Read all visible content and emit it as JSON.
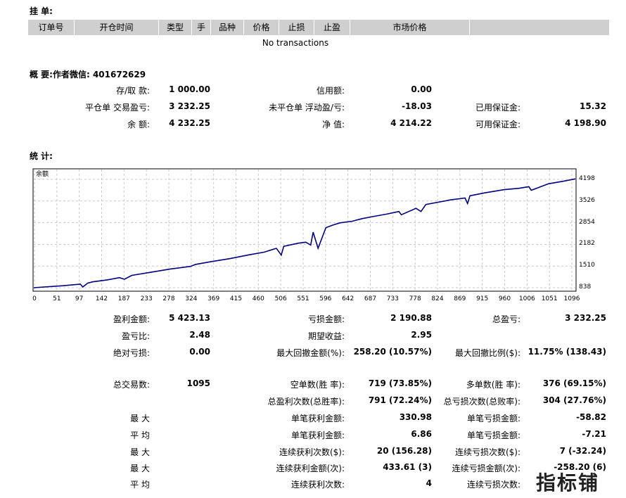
{
  "orders": {
    "title": "挂 单:",
    "columns": [
      "订单号",
      "开仓时间",
      "类型",
      "手",
      "品种",
      "价格",
      "止损",
      "止盈",
      "市场价格",
      ""
    ],
    "empty": "No transactions"
  },
  "summary": {
    "title": "概 要:作者微信: 401672629",
    "rows": [
      [
        [
          "存/取 款:",
          "1 000.00"
        ],
        [
          "信用额:",
          "0.00"
        ],
        [
          "",
          ""
        ]
      ],
      [
        [
          "平仓单 交易盈亏:",
          "3 232.25"
        ],
        [
          "未平仓单 浮动盈/亏:",
          "-18.03"
        ],
        [
          "已用保证金:",
          "15.32"
        ]
      ],
      [
        [
          "余 额:",
          "4 232.25"
        ],
        [
          "净 值:",
          "4 214.22"
        ],
        [
          "可用保证金:",
          "4 198.90"
        ]
      ]
    ]
  },
  "stats": {
    "title": "统 计:",
    "rows": [
      [
        [
          "盈利金额:",
          "5 423.13"
        ],
        [
          "亏损金额:",
          "2 190.88"
        ],
        [
          "总盈亏:",
          "3 232.25"
        ]
      ],
      [
        [
          "盈亏比:",
          "2.48"
        ],
        [
          "期望收益:",
          "2.95"
        ],
        [
          "",
          ""
        ]
      ],
      [
        [
          "绝对亏损:",
          "0.00"
        ],
        [
          "最大回撤金额(%):",
          "258.20 (10.57%)"
        ],
        [
          "最大回撤比例($):",
          "11.75% (138.43)"
        ]
      ],
      [
        [
          "总交易数:",
          "1095"
        ],
        [
          "空单数(胜 率):",
          "719 (73.85%)"
        ],
        [
          "多单数(胜 率):",
          "376 (69.15%)"
        ]
      ],
      [
        [
          "",
          ""
        ],
        [
          "总盈利次数(总胜率):",
          "791 (72.24%)"
        ],
        [
          "总亏损次数(总败率):",
          "304 (27.76%)"
        ]
      ],
      [
        [
          "最 大",
          ""
        ],
        [
          "单笔获利金额:",
          "330.98"
        ],
        [
          "单笔亏损金额:",
          "-58.82"
        ]
      ],
      [
        [
          "平 均",
          ""
        ],
        [
          "单笔获利金额:",
          "6.86"
        ],
        [
          "单笔亏损金额:",
          "-7.21"
        ]
      ],
      [
        [
          "最 大",
          ""
        ],
        [
          "连续获利次数($):",
          "20 (156.28)"
        ],
        [
          "连续亏损次数($):",
          "7 (-32.24)"
        ]
      ],
      [
        [
          "最 大",
          ""
        ],
        [
          "连续获利金额(次):",
          "433.61 (3)"
        ],
        [
          "连续亏损金额(次):",
          "-258.20 (6)"
        ]
      ],
      [
        [
          "平 均",
          ""
        ],
        [
          "连续获利次数:",
          "4"
        ],
        [
          "连续亏损次数:",
          ""
        ]
      ]
    ]
  },
  "watermark": "指标铺",
  "chart_data": {
    "type": "line",
    "series": [
      {
        "name": "余额",
        "color": "#000080",
        "x": [
          0,
          60,
          95,
          100,
          110,
          120,
          150,
          175,
          185,
          200,
          240,
          280,
          320,
          330,
          360,
          400,
          440,
          470,
          495,
          505,
          510,
          540,
          555,
          565,
          570,
          580,
          596,
          610,
          625,
          650,
          670,
          690,
          720,
          745,
          750,
          780,
          790,
          800,
          850,
          880,
          885,
          890,
          920,
          960,
          990,
          1010,
          1015,
          1050,
          1080,
          1105
        ],
        "y": [
          838,
          900,
          950,
          860,
          980,
          1020,
          1080,
          1150,
          1100,
          1220,
          1320,
          1420,
          1500,
          1560,
          1640,
          1740,
          1860,
          1940,
          2060,
          1850,
          2120,
          2220,
          2250,
          2160,
          2560,
          2060,
          2700,
          2780,
          2850,
          2900,
          2980,
          3040,
          3120,
          3200,
          3100,
          3300,
          3200,
          3420,
          3560,
          3620,
          3450,
          3690,
          3780,
          3880,
          3920,
          3970,
          3860,
          4060,
          4140,
          4214
        ]
      }
    ],
    "x_ticks": [
      "0",
      "51",
      "97",
      "142",
      "187",
      "233",
      "278",
      "324",
      "369",
      "415",
      "460",
      "506",
      "551",
      "596",
      "642",
      "687",
      "733",
      "778",
      "824",
      "869",
      "915",
      "960",
      "1006",
      "1051",
      "1096"
    ],
    "y_ticks": [
      "4198",
      "3526",
      "2854",
      "2182",
      "1510",
      "838"
    ],
    "xlim": [
      0,
      1105
    ],
    "ylim": [
      838,
      4198
    ],
    "grid": true
  }
}
